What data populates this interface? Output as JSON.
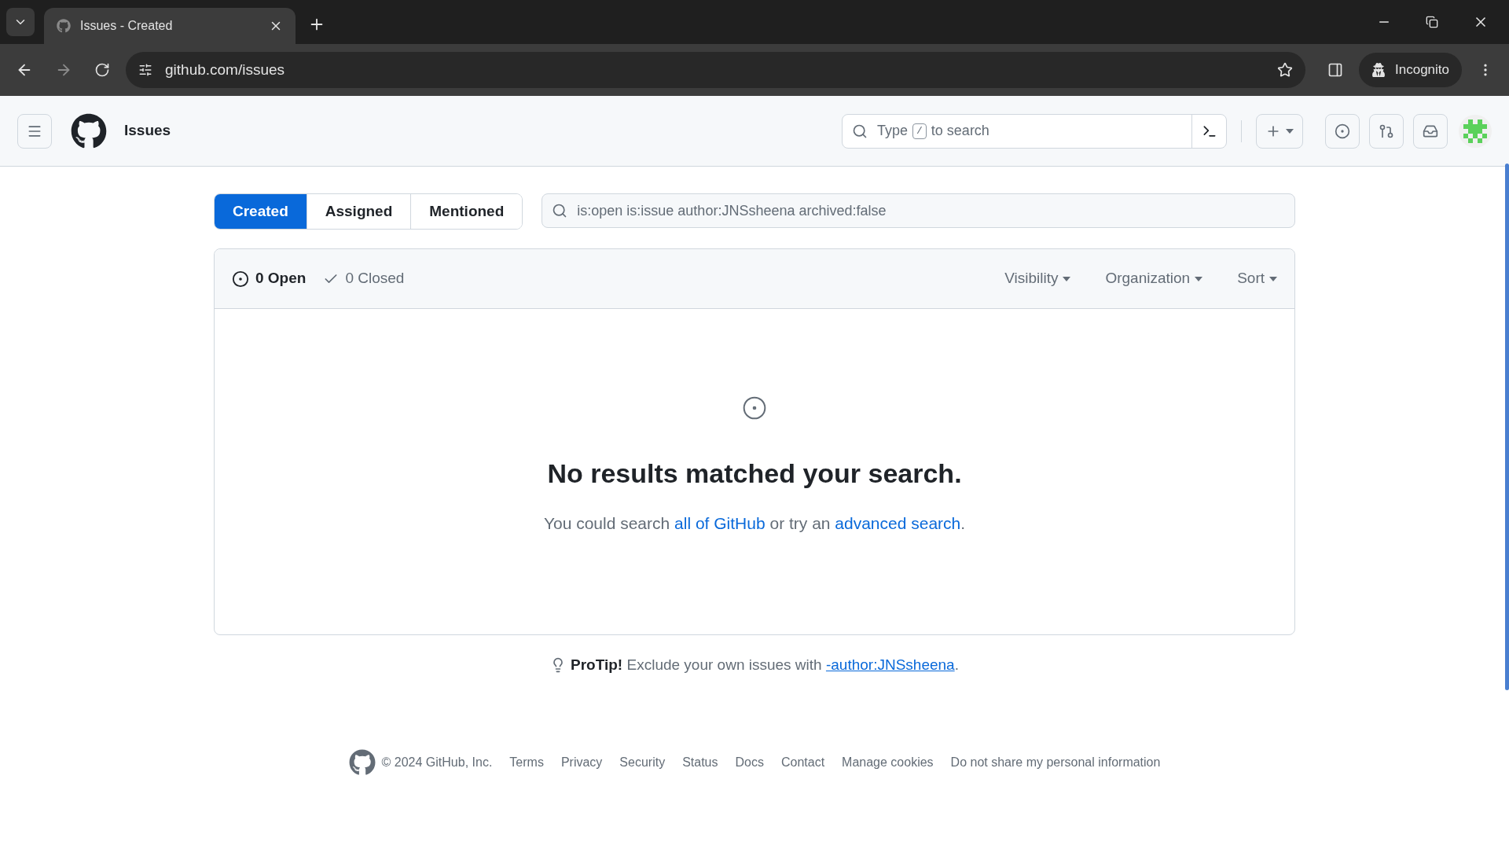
{
  "browser": {
    "tab": {
      "title": "Issues - Created",
      "selected": true
    },
    "address": "github.com/issues",
    "profile": "Incognito"
  },
  "header": {
    "title": "Issues",
    "search": {
      "before": "Type",
      "key": "/",
      "after": "to search"
    }
  },
  "tabs": [
    {
      "label": "Created",
      "selected": true
    },
    {
      "label": "Assigned",
      "selected": false
    },
    {
      "label": "Mentioned",
      "selected": false
    }
  ],
  "filter": {
    "value": "is:open is:issue author:JNSsheena archived:false"
  },
  "states": [
    {
      "kind": "open",
      "label": "0 Open",
      "selected": true
    },
    {
      "kind": "closed",
      "label": "0 Closed",
      "selected": false
    }
  ],
  "menus": [
    "Visibility",
    "Organization",
    "Sort"
  ],
  "empty": {
    "heading": "No results matched your search.",
    "hint": [
      {
        "kind": "text",
        "text": "You could search "
      },
      {
        "kind": "link",
        "text": "all of GitHub"
      },
      {
        "kind": "text",
        "text": " or try an "
      },
      {
        "kind": "link",
        "text": "advanced search"
      },
      {
        "kind": "text",
        "text": "."
      }
    ]
  },
  "protip": [
    {
      "kind": "text",
      "text": "**ProTip!** Exclude your own issues with "
    },
    {
      "kind": "link",
      "text": "-author:JNSsheena"
    },
    {
      "kind": "text",
      "text": "."
    }
  ],
  "footer": {
    "copyright": "© 2024 GitHub, Inc.",
    "links": [
      "Terms",
      "Privacy",
      "Security",
      "Status",
      "Docs",
      "Contact",
      "Manage cookies",
      "Do not share my personal information"
    ]
  }
}
